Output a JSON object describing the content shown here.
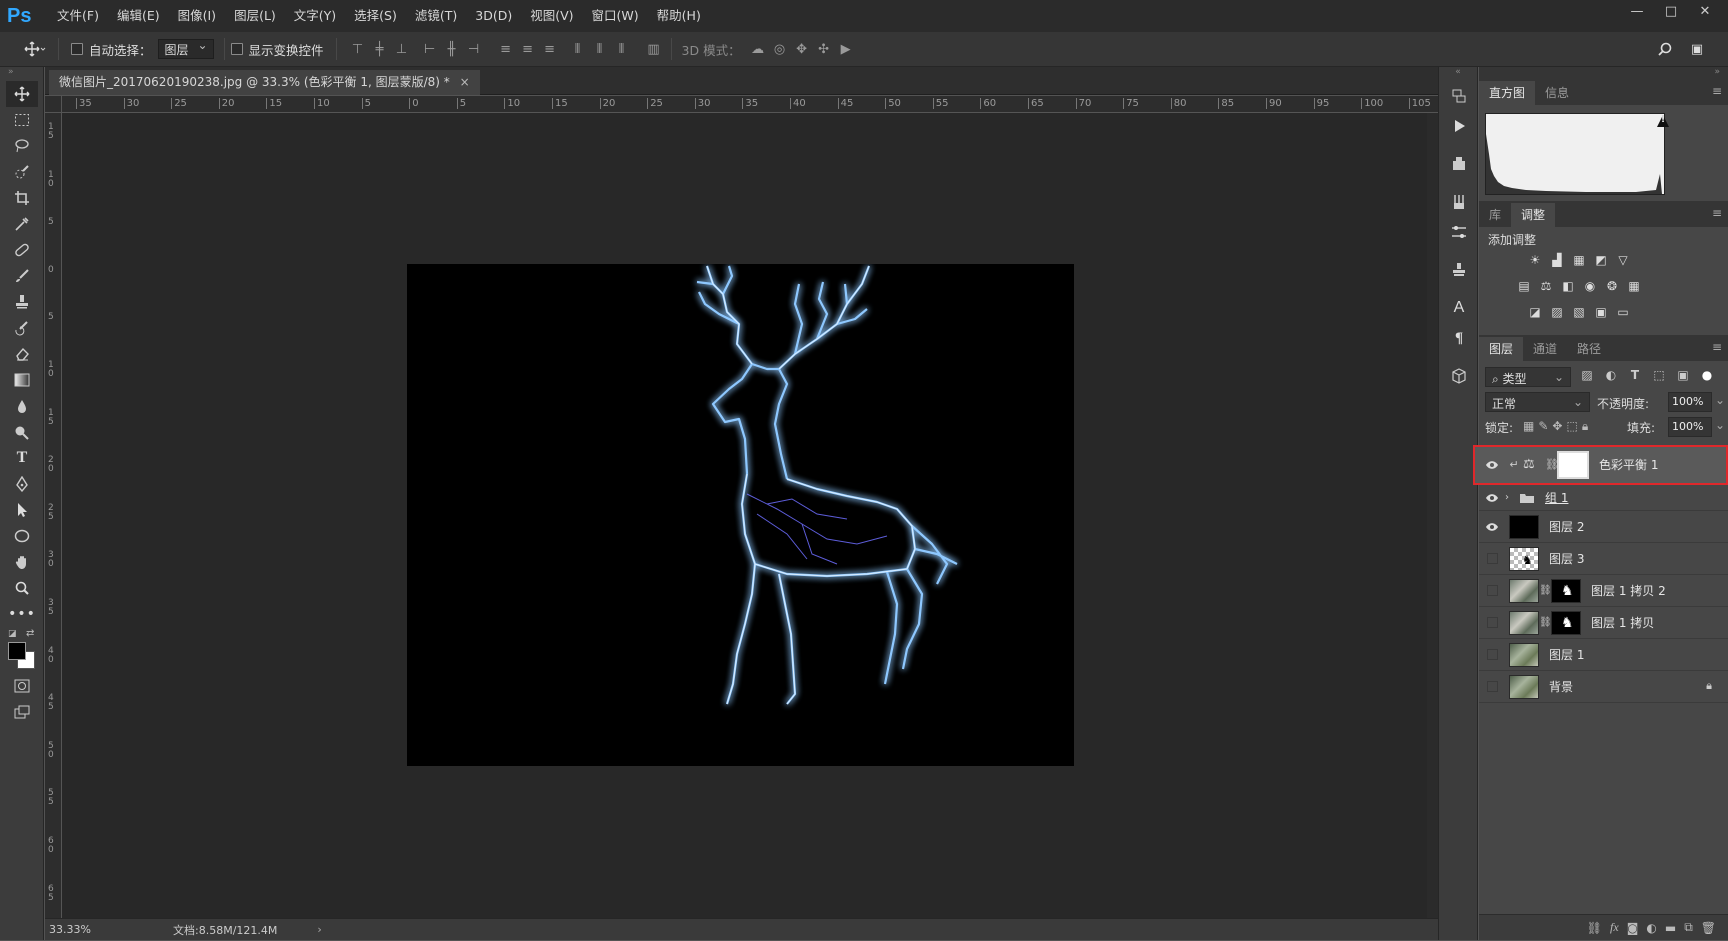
{
  "app": {
    "logo": "Ps"
  },
  "menu": [
    "文件(F)",
    "编辑(E)",
    "图像(I)",
    "图层(L)",
    "文字(Y)",
    "选择(S)",
    "滤镜(T)",
    "3D(D)",
    "视图(V)",
    "窗口(W)",
    "帮助(H)"
  ],
  "window_controls": {
    "minimize": "—",
    "restore": "□",
    "close": "✕"
  },
  "options_bar": {
    "auto_select_label": "自动选择：",
    "auto_select_value": "图层",
    "show_transform_label": "显示变换控件",
    "mode_3d_label": "3D 模式："
  },
  "document": {
    "tab_title": "微信图片_20170620190238.jpg @ 33.3% (色彩平衡 1, 图层蒙版/8) *",
    "tab_close": "×",
    "zoom": "33.33%",
    "doc_info": "文档:8.58M/121.4M",
    "status_arrow": "›"
  },
  "rulers": {
    "horizontal": [
      "35",
      "30",
      "25",
      "20",
      "15",
      "10",
      "5",
      "0",
      "5",
      "10",
      "15",
      "20",
      "25",
      "30",
      "35",
      "40",
      "45",
      "50",
      "55",
      "60",
      "65",
      "70",
      "75",
      "80",
      "85",
      "90",
      "95",
      "100",
      "105"
    ],
    "vertical": [
      "15",
      "10",
      "5",
      "0",
      "5",
      "10",
      "15",
      "20",
      "25",
      "30",
      "35",
      "40",
      "45",
      "50",
      "55",
      "60",
      "65"
    ]
  },
  "panels": {
    "histogram": {
      "tabs": [
        "直方图",
        "信息"
      ],
      "active": 0,
      "warning": "!"
    },
    "adjustments": {
      "tabs": [
        "库",
        "调整"
      ],
      "active": 1,
      "heading": "添加调整"
    },
    "layers": {
      "tabs": [
        "图层",
        "通道",
        "路径"
      ],
      "active": 0,
      "filter_label": "类型",
      "blend_mode": "正常",
      "opacity_label": "不透明度:",
      "opacity_value": "100%",
      "lock_label": "锁定:",
      "fill_label": "填充:",
      "fill_value": "100%",
      "items": [
        {
          "name": "色彩平衡 1",
          "visible": true,
          "selected": true,
          "kind": "adjustment"
        },
        {
          "name": "组 1",
          "visible": true,
          "kind": "group"
        },
        {
          "name": "图层 2",
          "visible": true,
          "kind": "black"
        },
        {
          "name": "图层 3",
          "visible": false,
          "kind": "deer-transparent"
        },
        {
          "name": "图层 1 拷贝 2",
          "visible": false,
          "kind": "masked"
        },
        {
          "name": "图层 1 拷贝",
          "visible": false,
          "kind": "masked"
        },
        {
          "name": "图层 1",
          "visible": false,
          "kind": "photo"
        },
        {
          "name": "背景",
          "visible": false,
          "kind": "photo",
          "locked": true
        }
      ]
    }
  },
  "colors": {
    "accent": "#31a8ff",
    "highlight_box": "#e0282b",
    "selected_layer": "#5a5a5a"
  }
}
